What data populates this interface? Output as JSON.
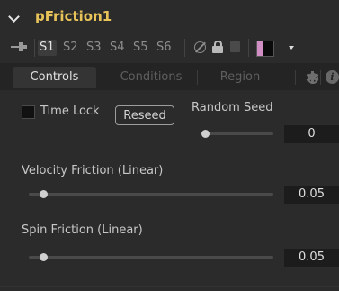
{
  "header": {
    "title": "pFriction1"
  },
  "toolbar": {
    "scenes": [
      "S1",
      "S2",
      "S3",
      "S4",
      "S5",
      "S6"
    ],
    "active_scene": "S1",
    "swatch_colors": [
      "#d08ec4",
      "#0a0a0a"
    ]
  },
  "tabs": [
    {
      "label": "Controls",
      "active": true
    },
    {
      "label": "Conditions",
      "active": false
    },
    {
      "label": "Region",
      "active": false
    }
  ],
  "controls": {
    "time_lock_label": "Time Lock",
    "time_lock_checked": false,
    "reseed_label": "Reseed",
    "random_seed": {
      "label": "Random Seed",
      "value": "0"
    },
    "velocity_friction": {
      "label": "Velocity Friction (Linear)",
      "value": "0.05"
    },
    "spin_friction": {
      "label": "Spin Friction (Linear)",
      "value": "0.05"
    }
  },
  "colors": {
    "title": "#e7c35a",
    "background": "#2b2b2b",
    "tab_bar": "#242424"
  }
}
